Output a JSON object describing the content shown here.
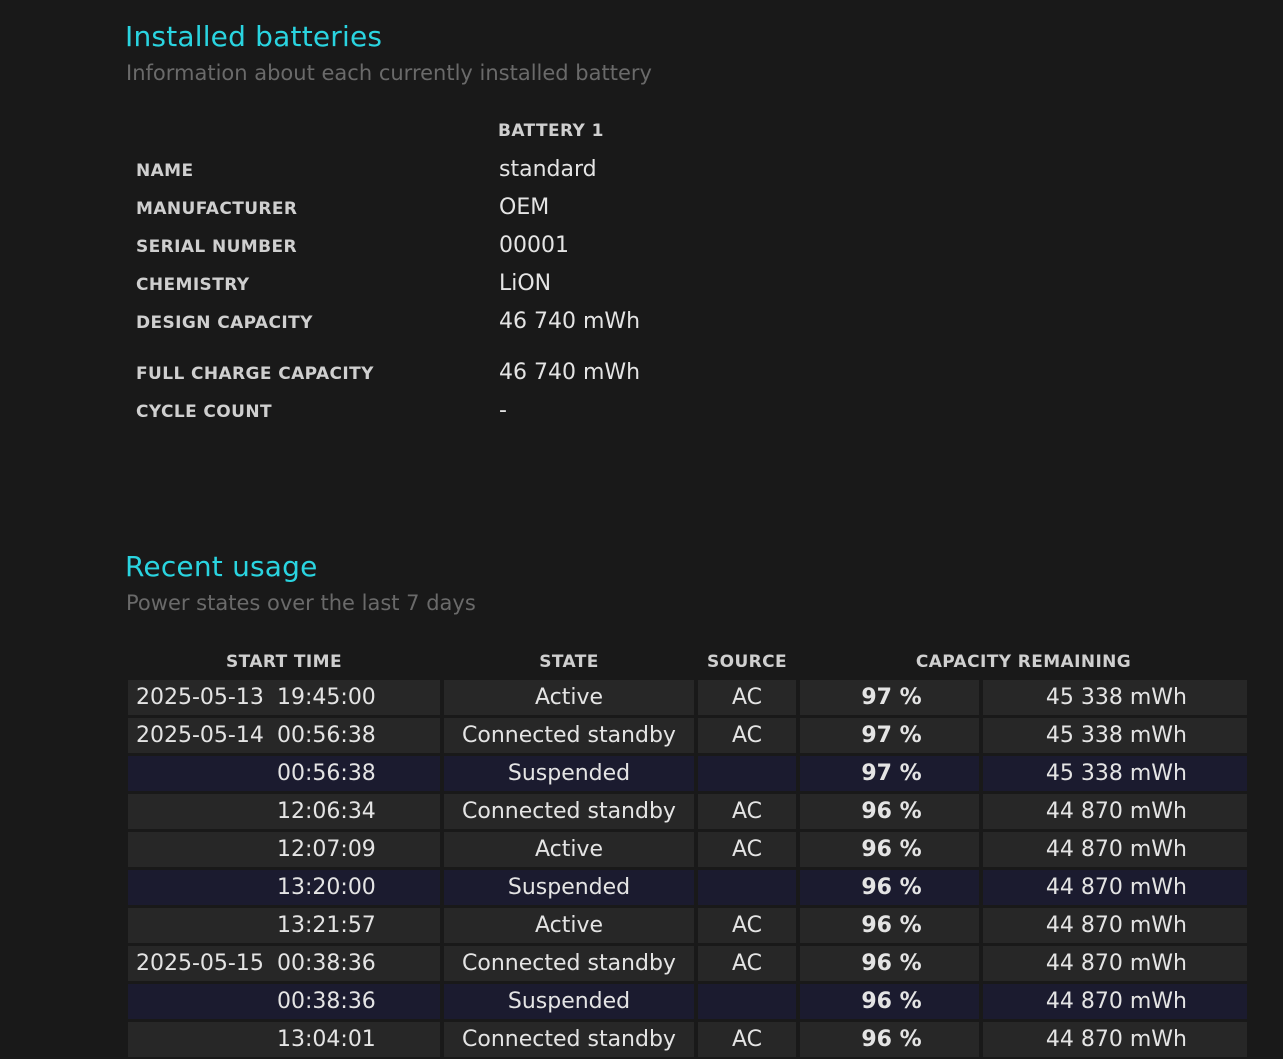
{
  "installed": {
    "title": "Installed batteries",
    "subtitle": "Information about each currently installed battery",
    "column_header": "BATTERY 1",
    "rows": [
      {
        "label": "NAME",
        "value": "standard"
      },
      {
        "label": "MANUFACTURER",
        "value": "OEM"
      },
      {
        "label": "SERIAL NUMBER",
        "value": "00001"
      },
      {
        "label": "CHEMISTRY",
        "value": "LiON"
      },
      {
        "label": "DESIGN CAPACITY",
        "value": "46 740 mWh"
      },
      {
        "label": "FULL CHARGE CAPACITY",
        "value": "46 740 mWh"
      },
      {
        "label": "CYCLE COUNT",
        "value": "-"
      }
    ]
  },
  "usage": {
    "title": "Recent usage",
    "subtitle": "Power states over the last 7 days",
    "headers": {
      "start_time": "START TIME",
      "state": "STATE",
      "source": "SOURCE",
      "capacity": "CAPACITY REMAINING"
    },
    "rows": [
      {
        "date": "2025-05-13",
        "time": "19:45:00",
        "state": "Active",
        "source": "AC",
        "percent": "97 %",
        "mwh": "45 338 mWh"
      },
      {
        "date": "2025-05-14",
        "time": "00:56:38",
        "state": "Connected standby",
        "source": "AC",
        "percent": "97 %",
        "mwh": "45 338 mWh"
      },
      {
        "date": "",
        "time": "00:56:38",
        "state": "Suspended",
        "source": "",
        "percent": "97 %",
        "mwh": "45 338 mWh"
      },
      {
        "date": "",
        "time": "12:06:34",
        "state": "Connected standby",
        "source": "AC",
        "percent": "96 %",
        "mwh": "44 870 mWh"
      },
      {
        "date": "",
        "time": "12:07:09",
        "state": "Active",
        "source": "AC",
        "percent": "96 %",
        "mwh": "44 870 mWh"
      },
      {
        "date": "",
        "time": "13:20:00",
        "state": "Suspended",
        "source": "",
        "percent": "96 %",
        "mwh": "44 870 mWh"
      },
      {
        "date": "",
        "time": "13:21:57",
        "state": "Active",
        "source": "AC",
        "percent": "96 %",
        "mwh": "44 870 mWh"
      },
      {
        "date": "2025-05-15",
        "time": "00:38:36",
        "state": "Connected standby",
        "source": "AC",
        "percent": "96 %",
        "mwh": "44 870 mWh"
      },
      {
        "date": "",
        "time": "00:38:36",
        "state": "Suspended",
        "source": "",
        "percent": "96 %",
        "mwh": "44 870 mWh"
      },
      {
        "date": "",
        "time": "13:04:01",
        "state": "Connected standby",
        "source": "AC",
        "percent": "96 %",
        "mwh": "44 870 mWh"
      }
    ]
  }
}
